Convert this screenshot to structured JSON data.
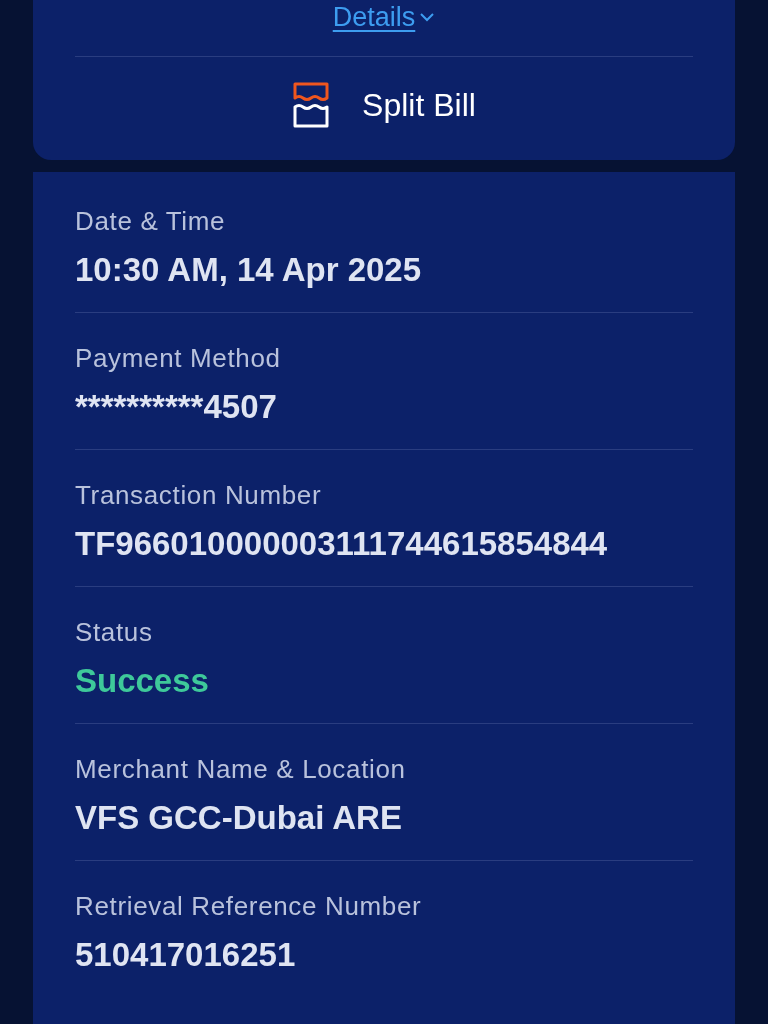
{
  "summary_card": {
    "details_link": "Details",
    "action": {
      "label": "Split Bill"
    }
  },
  "fields": [
    {
      "label": "Date & Time",
      "value": "10:30 AM, 14 Apr 2025",
      "kind": "text"
    },
    {
      "label": "Payment Method",
      "value": "**********4507",
      "kind": "text"
    },
    {
      "label": "Transaction Number",
      "value": "TF966010000003111744615854844",
      "kind": "text"
    },
    {
      "label": "Status",
      "value": "Success",
      "kind": "status"
    },
    {
      "label": "Merchant Name & Location",
      "value": "VFS GCC-Dubai ARE",
      "kind": "text"
    },
    {
      "label": "Retrieval Reference Number",
      "value": "510417016251",
      "kind": "text"
    }
  ]
}
